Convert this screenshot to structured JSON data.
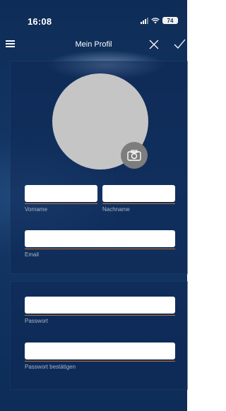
{
  "status_bar": {
    "time": "16:08",
    "battery": "74"
  },
  "header": {
    "title": "Mein Profil"
  },
  "profile": {
    "first_name": {
      "label": "Vorname",
      "value": ""
    },
    "last_name": {
      "label": "Nachname",
      "value": ""
    },
    "email": {
      "label": "Email",
      "value": ""
    }
  },
  "password": {
    "new": {
      "label": "Passwort",
      "value": ""
    },
    "confirm": {
      "label": "Passwort bestätigen",
      "value": ""
    }
  },
  "colors": {
    "background": "#143866",
    "accent_underline": "#c8722a",
    "avatar": "#c5c5c5",
    "camera": "#7d7d7d"
  },
  "icons": [
    "menu-icon",
    "close-icon",
    "checkmark-icon",
    "camera-icon",
    "signal-icon",
    "wifi-icon",
    "battery-icon"
  ]
}
